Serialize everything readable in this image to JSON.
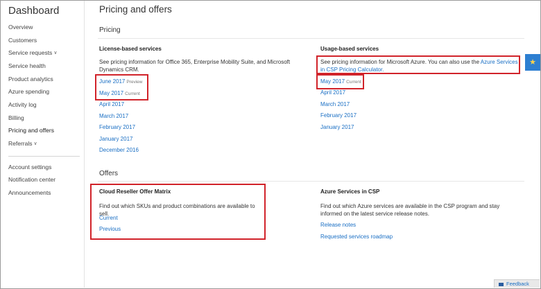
{
  "sidebar": {
    "title": "Dashboard",
    "items": [
      {
        "label": "Overview"
      },
      {
        "label": "Customers"
      },
      {
        "label": "Service requests"
      },
      {
        "label": "Service health"
      },
      {
        "label": "Product analytics"
      },
      {
        "label": "Azure spending"
      },
      {
        "label": "Activity log"
      },
      {
        "label": "Billing"
      },
      {
        "label": "Pricing and offers"
      },
      {
        "label": "Referrals"
      }
    ],
    "secondary_items": [
      {
        "label": "Account settings"
      },
      {
        "label": "Notification center"
      },
      {
        "label": "Announcements"
      }
    ]
  },
  "main": {
    "title": "Pricing and offers",
    "pricing": {
      "heading": "Pricing",
      "license": {
        "title": "License-based services",
        "description": "See pricing information for Office 365, Enterprise Mobility Suite, and Microsoft Dynamics CRM.",
        "links": [
          {
            "label": "June 2017",
            "tag": "Preview"
          },
          {
            "label": "May 2017",
            "tag": "Current"
          },
          {
            "label": "April 2017"
          },
          {
            "label": "March 2017"
          },
          {
            "label": "February 2017"
          },
          {
            "label": "January 2017"
          },
          {
            "label": "December 2016"
          }
        ]
      },
      "usage": {
        "title": "Usage-based services",
        "description_prefix": "See pricing information for Microsoft Azure. You can also use the ",
        "description_link": "Azure Services in CSP Pricing Calculator.",
        "links": [
          {
            "label": "May 2017",
            "tag": "Current"
          },
          {
            "label": "April 2017"
          },
          {
            "label": "March 2017"
          },
          {
            "label": "February 2017"
          },
          {
            "label": "January 2017"
          }
        ]
      }
    },
    "offers": {
      "heading": "Offers",
      "reseller": {
        "title": "Cloud Reseller Offer Matrix",
        "description": "Find out which SKUs and product combinations are available to sell.",
        "links": [
          {
            "label": "Current"
          },
          {
            "label": "Previous"
          }
        ]
      },
      "azure_csp": {
        "title": "Azure Services in CSP",
        "description": "Find out which Azure services are available in the CSP program and stay informed on the latest service release notes.",
        "links": [
          {
            "label": "Release notes"
          },
          {
            "label": "Requested services roadmap"
          }
        ]
      }
    }
  },
  "feedback": {
    "label": "Feedback"
  },
  "colors": {
    "link": "#1a6fc4",
    "highlight": "#d1232a",
    "star_button": "#2d7fd1"
  },
  "icons": {
    "star": "star-icon",
    "chevron": "chevron-down-icon",
    "feedback": "feedback-icon"
  }
}
